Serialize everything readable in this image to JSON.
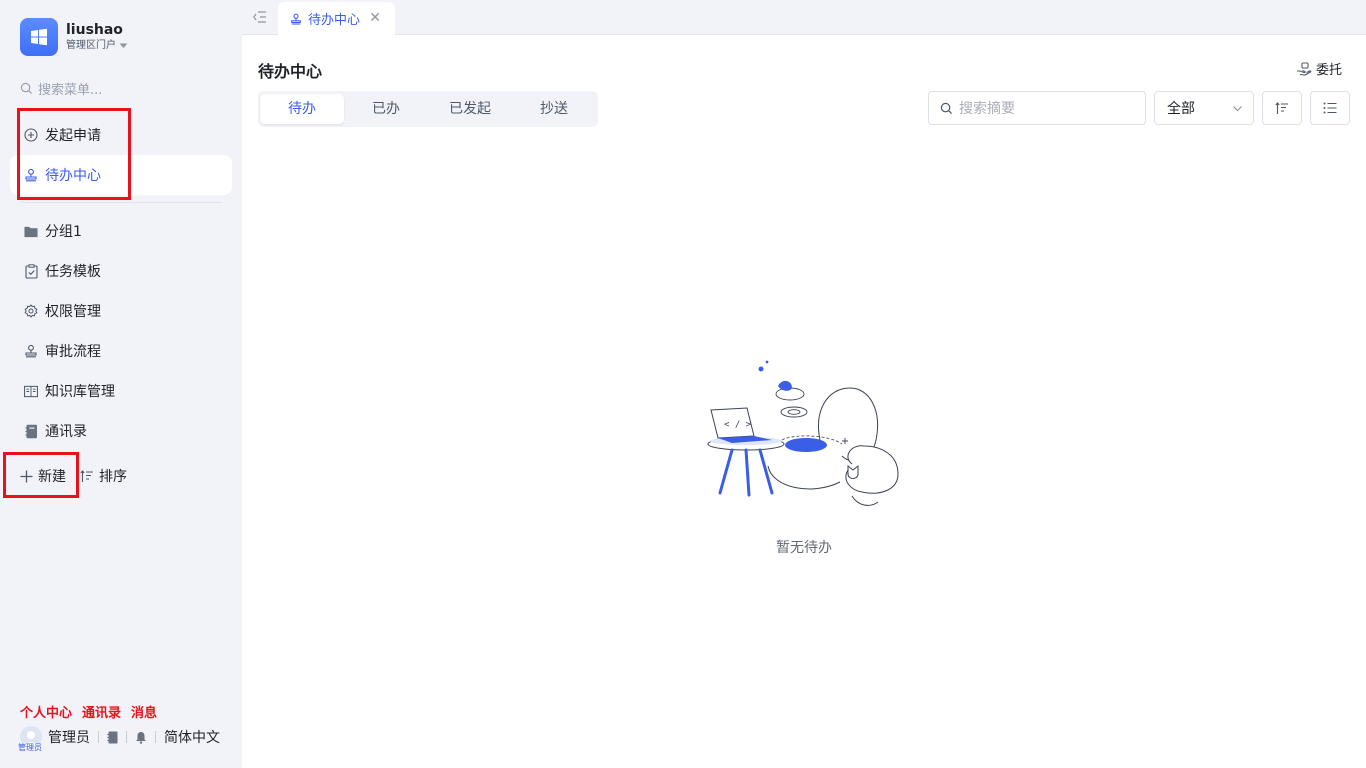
{
  "brand": {
    "name": "liushao",
    "portal": "管理区门户"
  },
  "sidebar": {
    "search_placeholder": "搜索菜单...",
    "quick": [
      {
        "label": "发起申请",
        "icon": "plus-circle-icon"
      },
      {
        "label": "待办中心",
        "icon": "stamp-icon",
        "active": true
      }
    ],
    "groups": [
      {
        "label": "分组1",
        "icon": "folder-icon"
      },
      {
        "label": "任务模板",
        "icon": "clipboard-check-icon"
      },
      {
        "label": "权限管理",
        "icon": "gear-icon"
      },
      {
        "label": "审批流程",
        "icon": "stamp-icon"
      },
      {
        "label": "知识库管理",
        "icon": "book-open-icon"
      },
      {
        "label": "通讯录",
        "icon": "contacts-book-icon"
      }
    ],
    "new_label": "新建",
    "sort_label": "排序",
    "red_links": [
      "个人中心",
      "通讯录",
      "消息"
    ],
    "footer": {
      "user": "管理员",
      "avatar_label": "管理员",
      "language": "简体中文"
    }
  },
  "tabbar": {
    "tab_label": "待办中心"
  },
  "main": {
    "title": "待办中心",
    "delegate_label": "委托",
    "tabs": [
      "待办",
      "已办",
      "已发起",
      "抄送"
    ],
    "active_tab": 0,
    "search_placeholder": "搜索摘要",
    "filter_value": "全部",
    "empty_text": "暂无待办"
  },
  "colors": {
    "accent": "#3a5ee6",
    "sidebar_bg": "#f1f3f9",
    "highlight_red": "#e8121c"
  }
}
